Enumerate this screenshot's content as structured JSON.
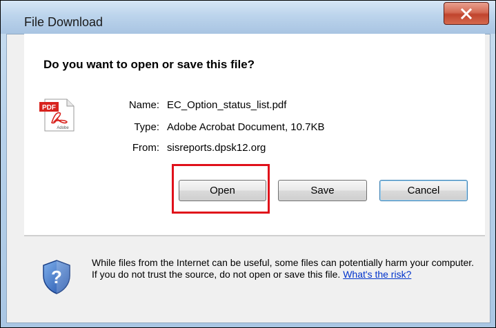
{
  "window": {
    "title": "File Download",
    "close_label": "X"
  },
  "dialog": {
    "question": "Do you want to open or save this file?",
    "file": {
      "name_label": "Name:",
      "name_value": "EC_Option_status_list.pdf",
      "type_label": "Type:",
      "type_value": "Adobe Acrobat Document, 10.7KB",
      "from_label": "From:",
      "from_value": "sisreports.dpsk12.org"
    },
    "icon": {
      "file_icon": "pdf-file-icon",
      "badge_text": "PDF",
      "brand_text": "Adobe"
    },
    "buttons": {
      "open": "Open",
      "save": "Save",
      "cancel": "Cancel"
    },
    "warning": {
      "text": "While files from the Internet can be useful, some files can potentially harm your computer. If you do not trust the source, do not open or save this file.",
      "link": "What's the risk?",
      "icon": "security-shield-icon"
    }
  },
  "colors": {
    "highlight": "#e0101a",
    "link": "#0033cc",
    "close_button": "#c0442d"
  }
}
